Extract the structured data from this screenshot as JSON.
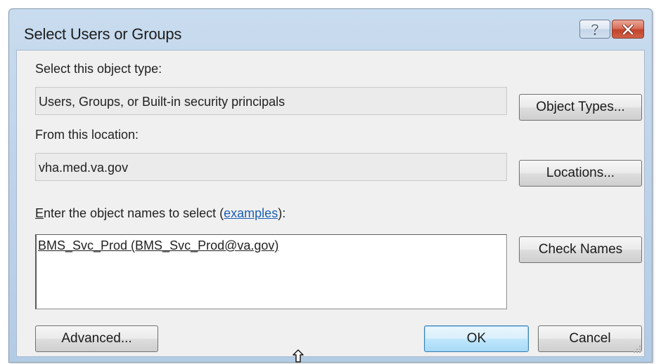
{
  "window": {
    "title": "Select Users or Groups"
  },
  "object_type": {
    "label": "Select this object type:",
    "value": "Users, Groups, or Built-in security principals",
    "button": "Object Types..."
  },
  "location": {
    "label": "From this location:",
    "value": "vha.med.va.gov",
    "button": "Locations..."
  },
  "names": {
    "label_accel": "E",
    "label_prefix": "nter the object names to select (",
    "label_link": "examples",
    "label_suffix": "):",
    "value": "BMS_Svc_Prod (BMS_Svc_Prod@va.gov)",
    "button": "Check Names"
  },
  "footer": {
    "advanced": "Advanced...",
    "ok": "OK",
    "cancel": "Cancel"
  },
  "icons": {
    "help": "question-mark-icon",
    "close": "close-x-icon",
    "cursor": "up-arrow-cursor-icon",
    "grip": "resize-grip-icon"
  },
  "colors": {
    "title_gradient": "#bcd2ea",
    "client_bg": "#f0f0f0",
    "link": "#1a5fb4",
    "close_button": "#c2432b",
    "default_button_border": "#3c7fb1"
  }
}
